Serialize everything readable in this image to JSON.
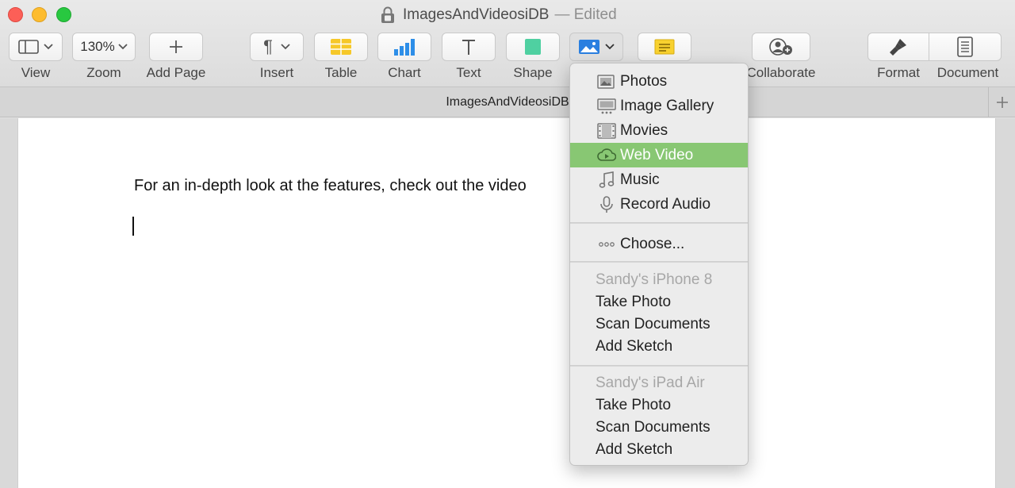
{
  "window": {
    "title": "ImagesAndVideosiDB",
    "edited": "— Edited"
  },
  "toolbar": {
    "view": "View",
    "zoom_value": "130%",
    "zoom": "Zoom",
    "add_page": "Add Page",
    "insert": "Insert",
    "table": "Table",
    "chart": "Chart",
    "text": "Text",
    "shape": "Shape",
    "collaborate": "Collaborate",
    "format": "Format",
    "document": "Document"
  },
  "tab": {
    "title": "ImagesAndVideosiDB"
  },
  "document": {
    "text": "For an in-depth look at the features, check out the video"
  },
  "media_menu": {
    "items": [
      {
        "label": "Photos",
        "icon": "photos-icon"
      },
      {
        "label": "Image Gallery",
        "icon": "image-gallery-icon"
      },
      {
        "label": "Movies",
        "icon": "movies-icon"
      },
      {
        "label": "Web Video",
        "icon": "web-video-icon",
        "selected": true
      },
      {
        "label": "Music",
        "icon": "music-icon"
      },
      {
        "label": "Record Audio",
        "icon": "microphone-icon"
      }
    ],
    "choose": "Choose...",
    "devices": [
      {
        "name": "Sandy's iPhone 8",
        "actions": [
          "Take Photo",
          "Scan Documents",
          "Add Sketch"
        ]
      },
      {
        "name": "Sandy's iPad Air",
        "actions": [
          "Take Photo",
          "Scan Documents",
          "Add Sketch"
        ]
      }
    ]
  },
  "colors": {
    "menu_highlight": "#88c773",
    "table_icon": "#f6c829",
    "chart_icon": "#2d8ee8",
    "shape_icon": "#4fd0a1",
    "media_icon": "#2a7fe0",
    "comment_icon": "#f8d12f"
  }
}
